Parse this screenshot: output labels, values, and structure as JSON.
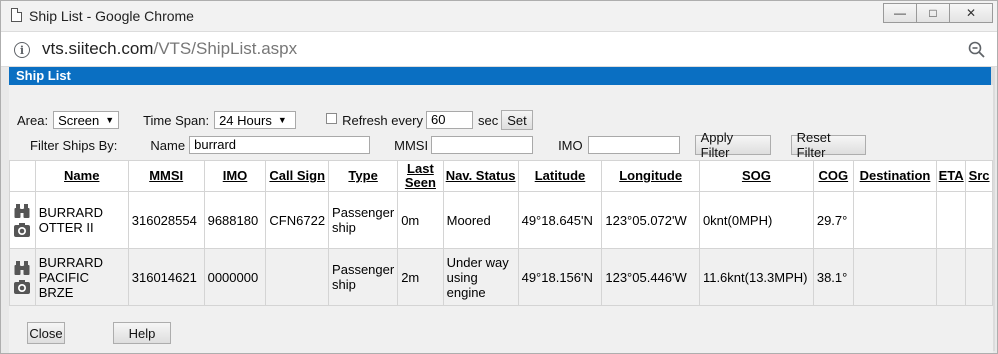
{
  "window": {
    "title": "Ship List - Google Chrome",
    "controls": {
      "minimize": "—",
      "maximize": "□",
      "close": "✕"
    }
  },
  "address": {
    "domain": "vts.siitech.com",
    "path": "/VTS/ShipList.aspx"
  },
  "panel": {
    "title": "Ship List"
  },
  "filters": {
    "area_label": "Area:",
    "area_value": "Screen",
    "timespan_label": "Time Span:",
    "timespan_value": "24 Hours",
    "refresh_label": "Refresh every",
    "refresh_value": "60",
    "refresh_unit": "sec",
    "set_label": "Set",
    "filter_label": "Filter Ships By:",
    "name_label": "Name",
    "name_value": "burrard",
    "mmsi_label": "MMSI",
    "mmsi_value": "",
    "imo_label": "IMO",
    "imo_value": "",
    "apply_label": "Apply Filter",
    "reset_label": "Reset Filter"
  },
  "table": {
    "headers": [
      "Name",
      "MMSI",
      "IMO",
      "Call Sign",
      "Type",
      "Last Seen",
      "Nav. Status",
      "Latitude",
      "Longitude",
      "SOG",
      "COG",
      "Destination",
      "ETA",
      "Src"
    ],
    "rows": [
      {
        "name": "BURRARD OTTER II",
        "mmsi": "316028554",
        "imo": "9688180",
        "callsign": "CFN6722",
        "type": "Passenger ship",
        "last_seen": "0m",
        "nav_status": "Moored",
        "latitude": "49°18.645'N",
        "longitude": "123°05.072'W",
        "sog": "0knt(0MPH)",
        "cog": "29.7°",
        "destination": "",
        "eta": "",
        "src": ""
      },
      {
        "name": "BURRARD PACIFIC BRZE",
        "mmsi": "316014621",
        "imo": "0000000",
        "callsign": "",
        "type": "Passenger ship",
        "last_seen": "2m",
        "nav_status": "Under way using engine",
        "latitude": "49°18.156'N",
        "longitude": "123°05.446'W",
        "sog": "11.6knt(13.3MPH)",
        "cog": "38.1°",
        "destination": "",
        "eta": "",
        "src": ""
      }
    ]
  },
  "footer": {
    "close_label": "Close",
    "help_label": "Help"
  },
  "icons": [
    "page-icon",
    "info-icon",
    "zoom-icon",
    "binoculars-icon",
    "camera-icon",
    "dropdown-arrow-icon",
    "checkbox-icon"
  ],
  "colors": {
    "header_bar": "#0a6fc2",
    "row_alt": "#f0f0f0"
  }
}
